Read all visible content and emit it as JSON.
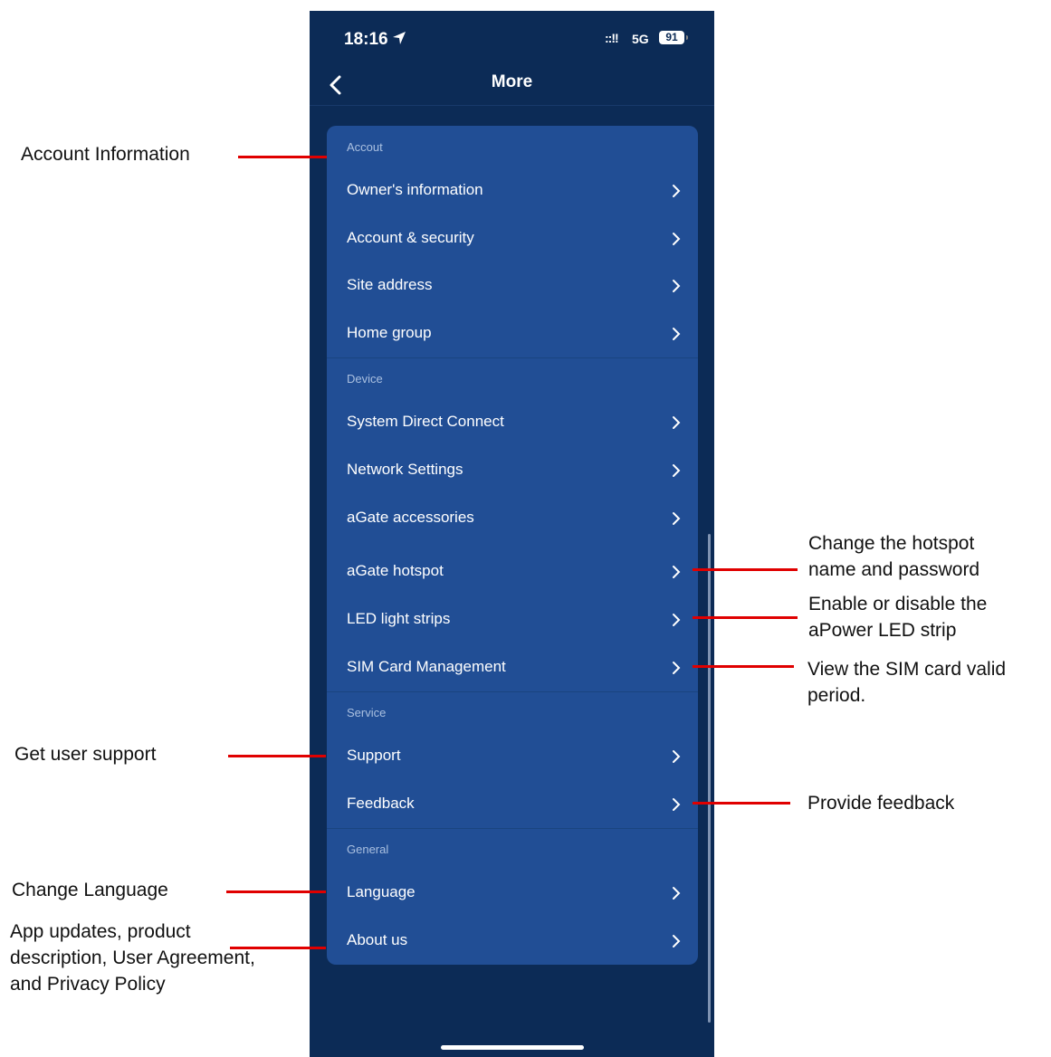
{
  "status_bar": {
    "time": "18:16",
    "signal": "::!!",
    "network": "5G",
    "battery": "91"
  },
  "header": {
    "title": "More"
  },
  "sections": {
    "account": {
      "label": "Accout",
      "items": [
        "Owner's information",
        "Account & security",
        "Site address",
        "Home group"
      ]
    },
    "device": {
      "label": "Device",
      "items": [
        "System Direct Connect",
        "Network Settings",
        "aGate accessories",
        "aGate hotspot",
        "LED light strips",
        "SIM Card Management"
      ]
    },
    "service": {
      "label": "Service",
      "items": [
        "Support",
        "Feedback"
      ]
    },
    "general": {
      "label": "General",
      "items": [
        "Language",
        "About us"
      ]
    }
  },
  "annotations": {
    "account_information": "Account Information",
    "hotspot": "Change the hotspot name and password",
    "led": "Enable or disable the aPower LED strip",
    "sim": "View the SIM card valid period.",
    "support": "Get user support",
    "feedback": "Provide feedback",
    "language": "Change Language",
    "about": "App updates, product description, User Agreement, and Privacy Policy"
  },
  "colors": {
    "background": "#0c2b56",
    "card": "#214e95",
    "annotation_line": "#e00000"
  }
}
